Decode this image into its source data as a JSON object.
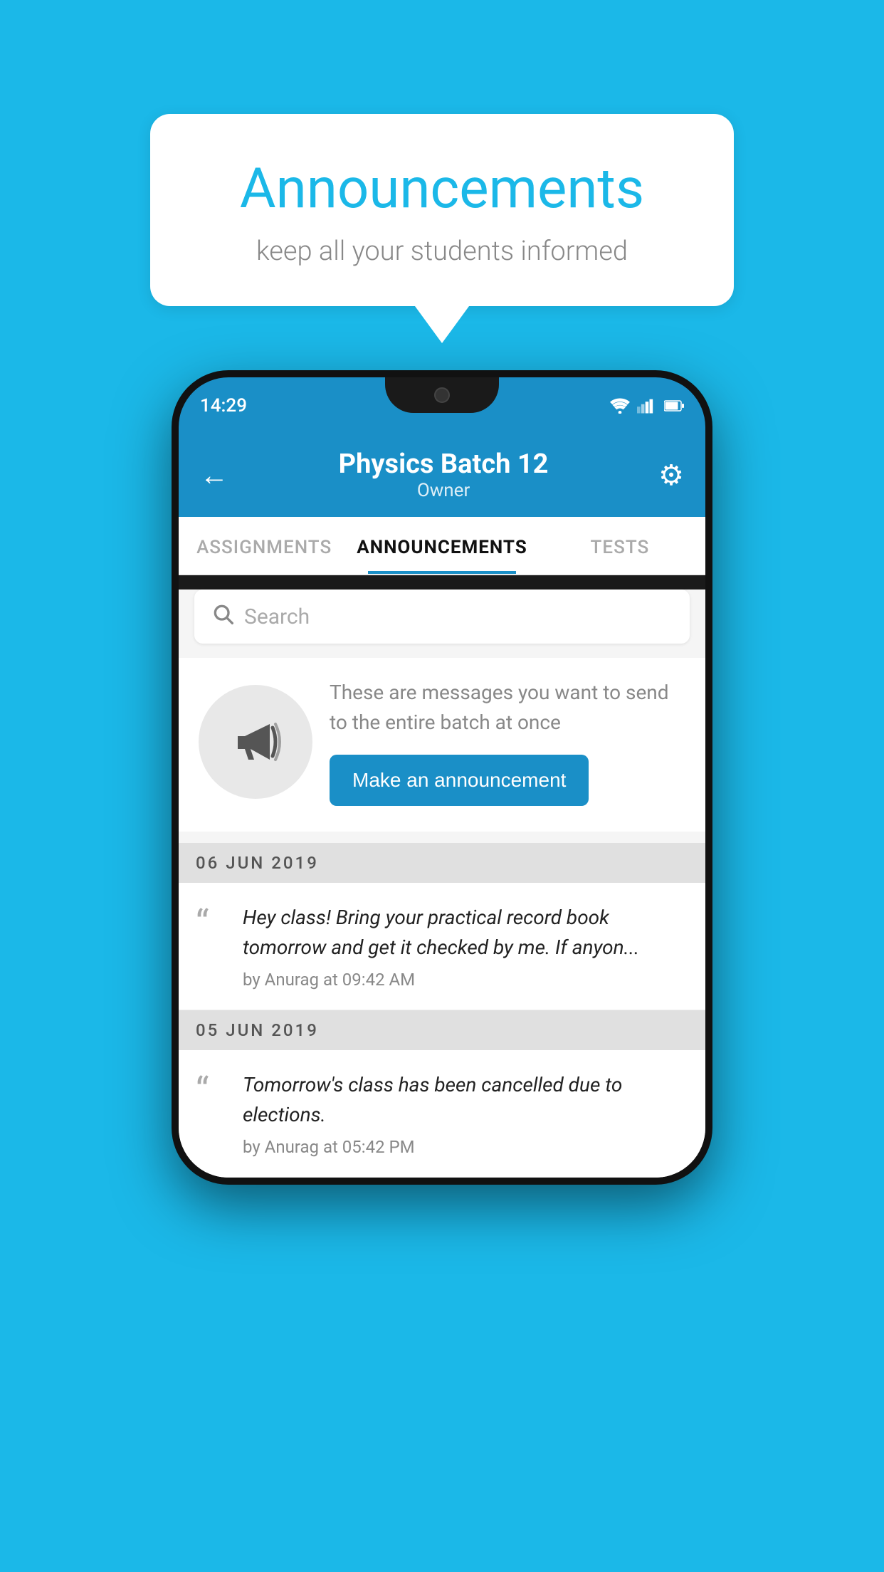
{
  "background_color": "#1BB8E8",
  "speech_bubble": {
    "title": "Announcements",
    "subtitle": "keep all your students informed"
  },
  "phone": {
    "status_bar": {
      "time": "14:29"
    },
    "header": {
      "title": "Physics Batch 12",
      "subtitle": "Owner",
      "back_label": "←",
      "gear_label": "⚙"
    },
    "tabs": [
      {
        "label": "ASSIGNMENTS",
        "active": false
      },
      {
        "label": "ANNOUNCEMENTS",
        "active": true
      },
      {
        "label": "TESTS",
        "active": false
      }
    ],
    "search": {
      "placeholder": "Search"
    },
    "promo": {
      "description": "These are messages you want to send to the entire batch at once",
      "button_label": "Make an announcement"
    },
    "announcements": [
      {
        "date": "06  JUN  2019",
        "message": "Hey class! Bring your practical record book tomorrow and get it checked by me. If anyon...",
        "meta": "by Anurag at 09:42 AM"
      },
      {
        "date": "05  JUN  2019",
        "message": "Tomorrow's class has been cancelled due to elections.",
        "meta": "by Anurag at 05:42 PM"
      }
    ]
  }
}
